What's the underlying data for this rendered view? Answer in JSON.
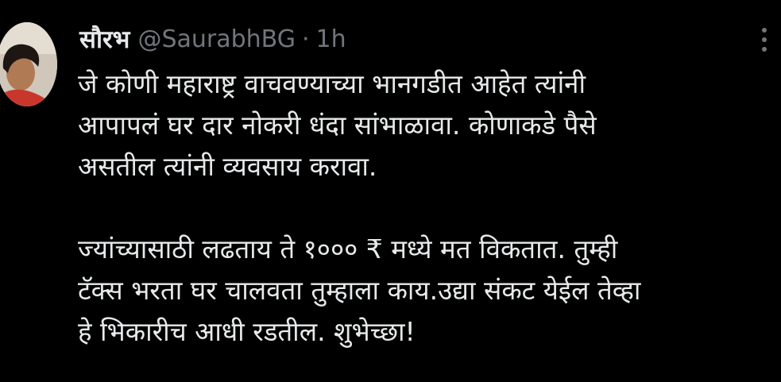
{
  "tweet": {
    "author": {
      "display_name": "सौरभ",
      "handle": "@SaurabhBG",
      "separator": "·",
      "time": "1h"
    },
    "more_icon": "more-vertical-icon",
    "paragraphs": [
      [
        "जे कोणी महाराष्ट्र वाचवण्याच्या भानगडीत आहेत त्यांनी",
        "आपापलं घर दार नोकरी धंदा सांभाळावा. कोणाकडे पैसे",
        "असतील त्यांनी व्यवसाय करावा."
      ],
      [
        "ज्यांच्यासाठी लढताय ते १००० ₹ मध्ये मत विकतात. तुम्ही",
        "टॅक्स भरता घर चालवता तुम्हाला काय.उद्या संकट येईल तेव्हा",
        "हे भिकारीच आधी रडतील. शुभेच्छा!"
      ]
    ]
  },
  "colors": {
    "background": "#000000",
    "text_primary": "#e7e9ea",
    "text_secondary": "#71767b"
  }
}
